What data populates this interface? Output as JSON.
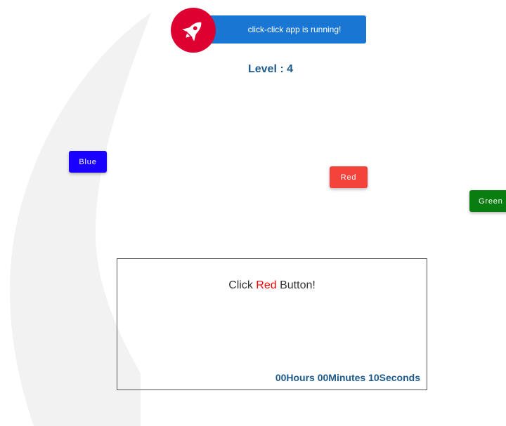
{
  "app": {
    "banner_text": "click-click app is running!",
    "brand_color": "#dd0031",
    "banner_color": "#1976d2"
  },
  "game": {
    "level_label": "Level : 4",
    "buttons": {
      "blue": {
        "label": "Blue",
        "color": "#1a00ff"
      },
      "red": {
        "label": "Red",
        "color": "#f4433b"
      },
      "green": {
        "label": "Green",
        "color": "#0a7d11"
      }
    },
    "instruction": {
      "prefix": "Click ",
      "color_word": "Red",
      "suffix": " Button!"
    },
    "timer": "00Hours 00Minutes 10Seconds"
  },
  "icons": [
    "rocket-icon"
  ]
}
